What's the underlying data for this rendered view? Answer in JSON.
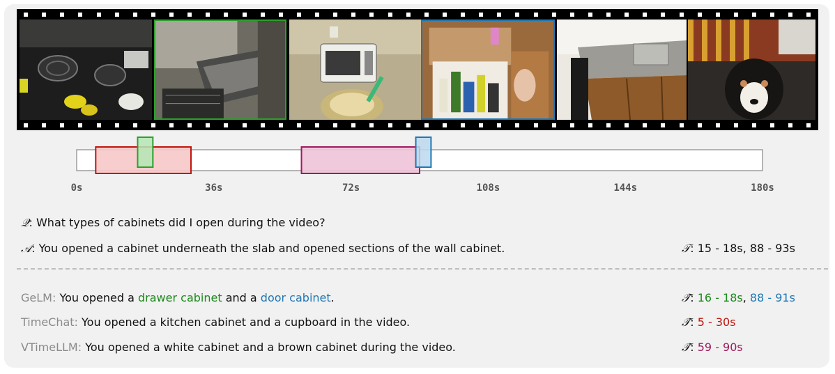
{
  "timeline": {
    "axis": {
      "min": 0,
      "max": 180,
      "ticks": [
        "0s",
        "36s",
        "72s",
        "108s",
        "144s",
        "180s"
      ]
    },
    "segments": [
      {
        "name": "TimeChat",
        "start": 5,
        "end": 30,
        "color": "#c0150e",
        "fill": "#f7c8c8",
        "lane": "wide"
      },
      {
        "name": "VTimeLLM",
        "start": 59,
        "end": 90,
        "color": "#a0195c",
        "fill": "#eec4d8",
        "lane": "wide"
      },
      {
        "name": "GeLM-1",
        "start": 16,
        "end": 20,
        "color": "#2ca02c",
        "fill": "#b5e6b5",
        "lane": "tall"
      },
      {
        "name": "GeLM-2",
        "start": 89,
        "end": 93,
        "color": "#1f78b4",
        "fill": "#bcd8ee",
        "lane": "tall"
      }
    ]
  },
  "frames": [
    {
      "highlight": ""
    },
    {
      "highlight": "#2ca02c"
    },
    {
      "highlight": ""
    },
    {
      "highlight": "#1f78b4"
    },
    {
      "highlight": ""
    },
    {
      "highlight": ""
    }
  ],
  "question": {
    "symbol": "𝒬",
    "text": ":  What types of cabinets did I open during the video?"
  },
  "answer": {
    "symbol": "𝒜",
    "text": ":  You opened a cabinet underneath the slab and opened sections of the wall cabinet.",
    "time_symbol": "𝒯",
    "time": ":  15 - 18s, 88 - 93s"
  },
  "predictions": [
    {
      "model": "GeLM:",
      "text_a": " You opened a ",
      "hl1": "drawer cabinet",
      "text_b": " and a ",
      "hl2": "door cabinet",
      "text_c": ".",
      "time_symbol": "𝒯̂",
      "time_sep": ":  ",
      "time1": "16 - 18s",
      "comma": ", ",
      "time2": "88 - 91s"
    },
    {
      "model": "TimeChat:",
      "text": " You opened a kitchen cabinet and a cupboard in the video.",
      "time_symbol": "𝒯̂",
      "time_sep": ":  ",
      "time": "5 - 30s"
    },
    {
      "model": "VTimeLLM:",
      "text": " You opened a white cabinet and a brown cabinet during the video.",
      "time_symbol": "𝒯̂",
      "time_sep": ":  ",
      "time": "59 - 90s"
    }
  ]
}
